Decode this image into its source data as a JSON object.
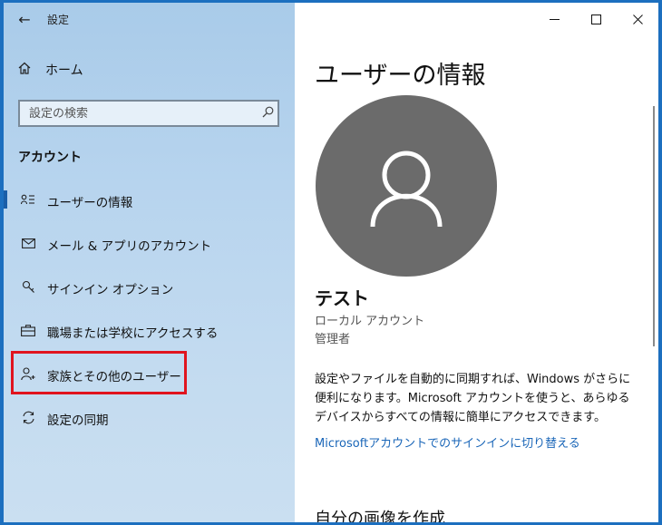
{
  "app": {
    "title": "設定",
    "back_icon": "←"
  },
  "sidebar": {
    "home_label": "ホーム",
    "search_placeholder": "設定の検索",
    "section_label": "アカウント",
    "items": [
      {
        "label": "ユーザーの情報",
        "icon": "user-info-icon",
        "glyph": "≡",
        "active": true
      },
      {
        "label": "メール & アプリのアカウント",
        "icon": "mail-icon",
        "glyph": "✉",
        "active": false
      },
      {
        "label": "サインイン オプション",
        "icon": "key-icon",
        "glyph": "⚿",
        "active": false
      },
      {
        "label": "職場または学校にアクセスする",
        "icon": "briefcase-icon",
        "glyph": "▣",
        "active": false
      },
      {
        "label": "家族とその他のユーザー",
        "icon": "add-person-icon",
        "glyph": "⚲",
        "active": false
      },
      {
        "label": "設定の同期",
        "icon": "sync-icon",
        "glyph": "⟳",
        "active": false
      }
    ]
  },
  "window_controls": {
    "minimize": "—",
    "maximize": "☐",
    "close": "✕"
  },
  "main": {
    "page_title": "ユーザーの情報",
    "user_name": "テスト",
    "account_type": "ローカル アカウント",
    "role": "管理者",
    "info": "設定やファイルを自動的に同期すれば、Windows がさらに便利になります。Microsoft アカウントを使うと、あらゆるデバイスからすべての情報に簡単にアクセスできます。",
    "link": "Microsoftアカウントでのサインインに切り替える",
    "sub_heading": "自分の画像を作成"
  },
  "colors": {
    "accent": "#1a66b8",
    "highlight": "#e0141e",
    "avatar_bg": "#6b6b6b"
  }
}
